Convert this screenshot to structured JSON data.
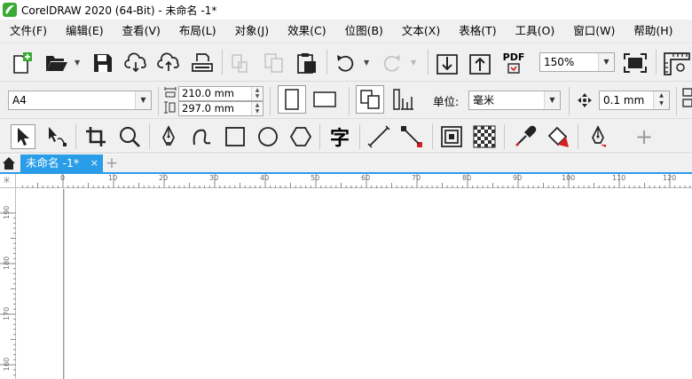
{
  "window": {
    "title": "CorelDRAW 2020 (64-Bit) - 未命名 -1*"
  },
  "menu": [
    {
      "label": "文件(F)"
    },
    {
      "label": "编辑(E)"
    },
    {
      "label": "查看(V)"
    },
    {
      "label": "布局(L)"
    },
    {
      "label": "对象(J)"
    },
    {
      "label": "效果(C)"
    },
    {
      "label": "位图(B)"
    },
    {
      "label": "文本(X)"
    },
    {
      "label": "表格(T)"
    },
    {
      "label": "工具(O)"
    },
    {
      "label": "窗口(W)"
    },
    {
      "label": "帮助(H)"
    }
  ],
  "standard_toolbar": {
    "zoom_level": "150%",
    "export_pdf_label": "PDF"
  },
  "property_bar": {
    "page_size": "A4",
    "page_width": "210.0 mm",
    "page_height": "297.0 mm",
    "units_label": "单位:",
    "units_value": "毫米",
    "nudge_distance": "0.1 mm"
  },
  "toolbox": {
    "text_tool_glyph": "字",
    "add_tool_glyph": "+"
  },
  "document_tabs": [
    {
      "label": "未命名 -1*",
      "active": true
    }
  ],
  "tab_close_glyph": "×",
  "tab_add_glyph": "+",
  "rulers": {
    "unit_marker": "米",
    "horizontal": [
      "0",
      "10",
      "20",
      "30",
      "40",
      "50",
      "60",
      "70",
      "80",
      "90",
      "100",
      "110",
      "120"
    ],
    "vertical": [
      "190",
      "180",
      "170",
      "160"
    ]
  },
  "colors": {
    "accent": "#2a9de8",
    "logo_green": "#3aaa35",
    "pdf_red": "#d42020",
    "bg": "#f0f0f0"
  }
}
